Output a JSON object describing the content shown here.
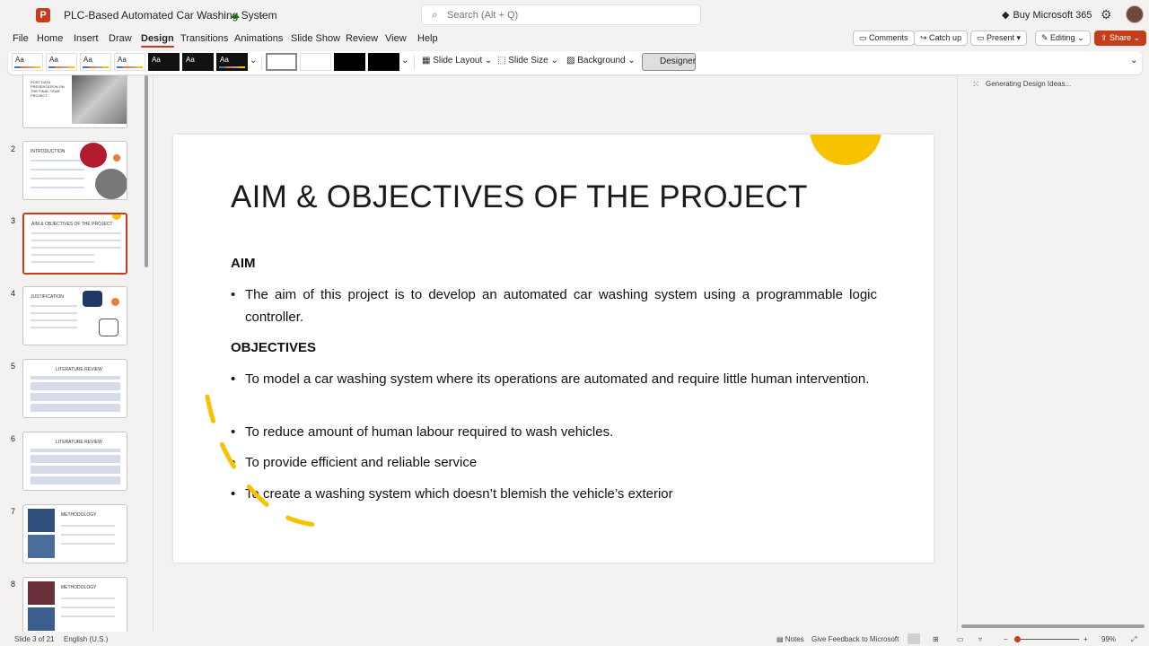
{
  "app": {
    "logo_letter": "P",
    "doc_title": "PLC-Based Automated Car Washing System",
    "search_placeholder": "Search (Alt + Q)",
    "buy_label": "Buy Microsoft 365",
    "accent_color": "#c43e1c"
  },
  "menu": {
    "items": [
      "File",
      "Home",
      "Insert",
      "Draw",
      "Design",
      "Transitions",
      "Animations",
      "Slide Show",
      "Review",
      "View",
      "Help"
    ],
    "active": "Design"
  },
  "right_buttons": {
    "comments": "Comments",
    "catch_up": "Catch up",
    "present": "Present",
    "editing": "Editing",
    "share": "Share"
  },
  "ribbon": {
    "theme_sample": "Aa",
    "slide_layout": "Slide Layout",
    "slide_size": "Slide Size",
    "background": "Background",
    "designer": "Designer"
  },
  "thumbnails": {
    "numbers": [
      "2",
      "3",
      "4",
      "5",
      "6",
      "7",
      "8"
    ],
    "titles": [
      "INTRODUCTION",
      "AIM & OBJECTIVES OF THE PROJECT",
      "JUSTIFICATION",
      "LITERATURE REVIEW",
      "LITERATURE REVIEW",
      "METHODOLOGY",
      "METHODOLOGY"
    ],
    "first_title": "POST DATA PRESENTATION ON THE FINAL-YEAR PROJECT",
    "selected": "3"
  },
  "slide": {
    "title": "AIM & OBJECTIVES OF THE PROJECT",
    "aim_heading": "AIM",
    "aim_text": "The aim of this project is to develop an automated car washing system using a programmable logic controller.",
    "objectives_heading": "OBJECTIVES",
    "objectives": [
      "To model a car washing system where its operations are automated and require little human intervention.",
      "To reduce amount of human labour required to wash vehicles.",
      "To provide efficient and reliable service",
      "To create a washing system which doesn’t blemish the vehicle’s exterior"
    ],
    "bullet_char": "•",
    "decor_color": "#f7c300"
  },
  "designer_pane": {
    "status": "Generating Design Ideas..."
  },
  "status_bar": {
    "slide_counter": "Slide 3 of 21",
    "language": "English (U.S.)",
    "notes": "Notes",
    "feedback": "Give Feedback to Microsoft",
    "zoom_minus": "−",
    "zoom_plus": "+",
    "zoom": "99%"
  }
}
